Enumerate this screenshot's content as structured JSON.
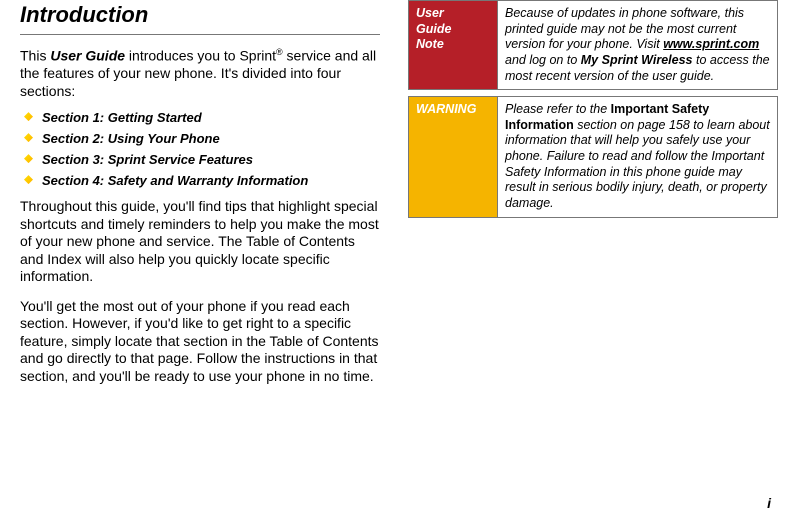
{
  "heading": "Introduction",
  "intro": {
    "pre": "This ",
    "ug": "User Guide",
    "mid": " introduces you to Sprint",
    "sup": "®",
    "post": " service and all the features of your new phone. It's divided into four sections:"
  },
  "sections": [
    "Section 1:  Getting Started",
    "Section 2:  Using Your Phone",
    "Section 3:  Sprint Service Features",
    "Section 4:  Safety and Warranty Information"
  ],
  "para1": "Throughout this guide, you'll find tips that highlight special shortcuts and timely reminders to help you make the most of your new phone and service. The Table of Contents and Index will also help you quickly locate specific information.",
  "para2": "You'll get the most out of your phone if you read each section. However, if you'd like to get right to a specific feature, simply locate that section in the Table of Contents and go directly to that page. Follow the instructions in that section, and you'll be ready to use your phone in no time.",
  "note": {
    "label_l1": "User",
    "label_l2": "Guide",
    "label_l3": "Note",
    "body_pre": "Because of updates in phone software, this printed guide may not be the most current version for your phone. Visit ",
    "body_link": "www.sprint.com",
    "body_mid": " and log on to ",
    "body_bold": "My Sprint Wireless",
    "body_post": " to access the most recent version of the user guide."
  },
  "warning": {
    "label": "WARNING",
    "body_pre": "Please refer to the ",
    "body_bold": "Important Safety Information",
    "body_post": " section on page 158 to learn about information that will help you safely use your phone. Failure to read and follow the Important Safety Information in this phone guide may result in serious bodily injury, death, or property damage."
  },
  "page_number": "i"
}
